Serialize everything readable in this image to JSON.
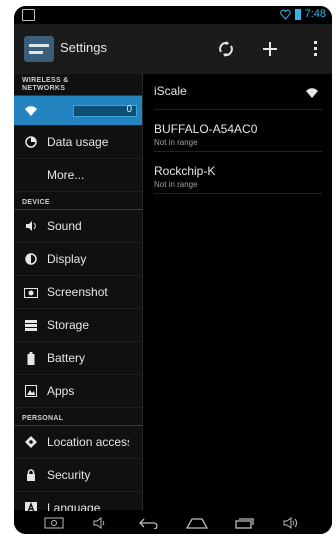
{
  "status_bar": {
    "time": "7:48"
  },
  "action_bar": {
    "title": "Settings"
  },
  "sidebar": {
    "sections": [
      {
        "header": "WIRELESS & NETWORKS"
      },
      {
        "header": "DEVICE"
      },
      {
        "header": "PERSONAL"
      }
    ],
    "wifi_toggle_value": "0",
    "items": [
      {
        "label": "Data usage",
        "icon": "data-usage-icon"
      },
      {
        "label": "More...",
        "icon": ""
      },
      {
        "label": "Sound",
        "icon": "sound-icon"
      },
      {
        "label": "Display",
        "icon": "display-icon"
      },
      {
        "label": "Screenshot",
        "icon": "camera-icon"
      },
      {
        "label": "Storage",
        "icon": "storage-icon"
      },
      {
        "label": "Battery",
        "icon": "battery-icon"
      },
      {
        "label": "Apps",
        "icon": "apps-icon"
      },
      {
        "label": "Location access",
        "icon": "location-icon"
      },
      {
        "label": "Security",
        "icon": "lock-icon"
      },
      {
        "label": "Language",
        "icon": "language-icon"
      }
    ]
  },
  "networks": [
    {
      "ssid": "iScale",
      "status": ""
    },
    {
      "ssid": "BUFFALO-A54AC0",
      "status": "Not in range"
    },
    {
      "ssid": "Rockchip-K",
      "status": "Not in range"
    }
  ],
  "colors": {
    "accent": "#2484c0",
    "status_blue": "#33b5e5"
  }
}
